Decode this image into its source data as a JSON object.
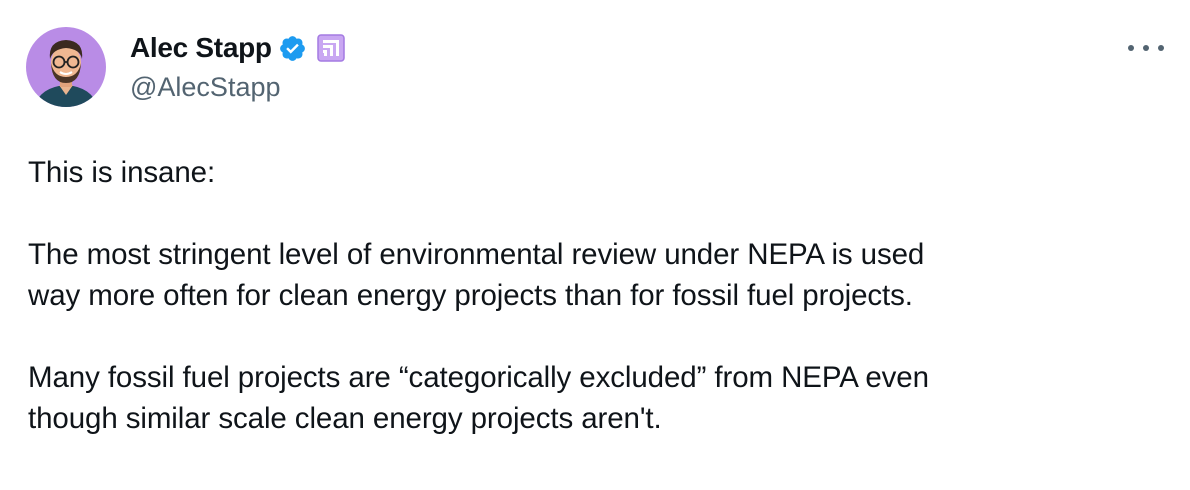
{
  "author": {
    "display_name": "Alec Stapp",
    "handle": "@AlecStapp"
  },
  "icons": {
    "verified": "verified-badge-icon",
    "affiliate": "affiliate-badge-icon",
    "more": "more-options-icon",
    "verified_color": "#1d9bf0",
    "affiliate_color": "#a47ae2"
  },
  "tweet": {
    "paragraphs": [
      "This is insane:",
      "The most stringent level of environmental review under NEPA is used",
      "way more often for clean energy projects than for fossil fuel projects.",
      "Many fossil fuel projects are “categorically excluded” from NEPA even",
      "though similar scale clean energy projects aren't."
    ]
  }
}
